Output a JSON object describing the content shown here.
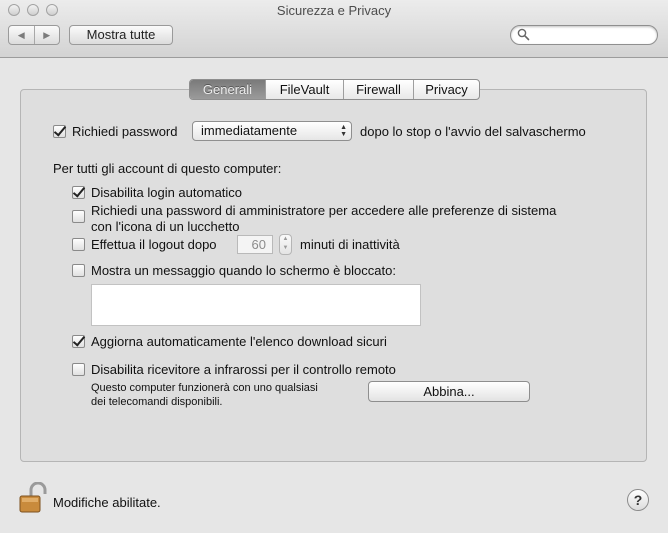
{
  "window": {
    "title": "Sicurezza e Privacy"
  },
  "toolbar": {
    "back_glyph": "◀",
    "forward_glyph": "▶",
    "show_all_label": "Mostra tutte",
    "search": {
      "value": "",
      "placeholder": ""
    }
  },
  "tabs": [
    {
      "label": "Generali",
      "active": true
    },
    {
      "label": "FileVault",
      "active": false
    },
    {
      "label": "Firewall",
      "active": false
    },
    {
      "label": "Privacy",
      "active": false
    }
  ],
  "general": {
    "require_password": {
      "label": "Richiedi password",
      "checked": true,
      "select_value": "immediatamente",
      "suffix": "dopo lo stop o l'avvio del salvaschermo"
    },
    "accounts_heading": "Per tutti gli account di questo computer:",
    "disable_autologin": {
      "label": "Disabilita login automatico",
      "checked": true
    },
    "admin_password": {
      "label_line1": "Richiedi una password di amministratore per accedere alle preferenze di sistema",
      "label_line2": "con l'icona di un lucchetto",
      "checked": false
    },
    "logout": {
      "label": "Effettua il logout dopo",
      "minutes": "60",
      "suffix": "minuti di inattività",
      "checked": false
    },
    "lock_message": {
      "label": "Mostra un messaggio quando lo schermo è bloccato:",
      "value": "",
      "checked": false
    },
    "auto_update_downloads": {
      "label": "Aggiorna automaticamente l'elenco download sicuri",
      "checked": true
    },
    "infrared": {
      "label": "Disabilita ricevitore a infrarossi per il controllo remoto",
      "checked": false,
      "note_line1": "Questo computer funzionerà con uno qualsiasi",
      "note_line2": "dei telecomandi disponibili.",
      "pair_button": "Abbina..."
    }
  },
  "footer": {
    "lock_label": "Modifiche abilitate.",
    "help_glyph": "?"
  }
}
